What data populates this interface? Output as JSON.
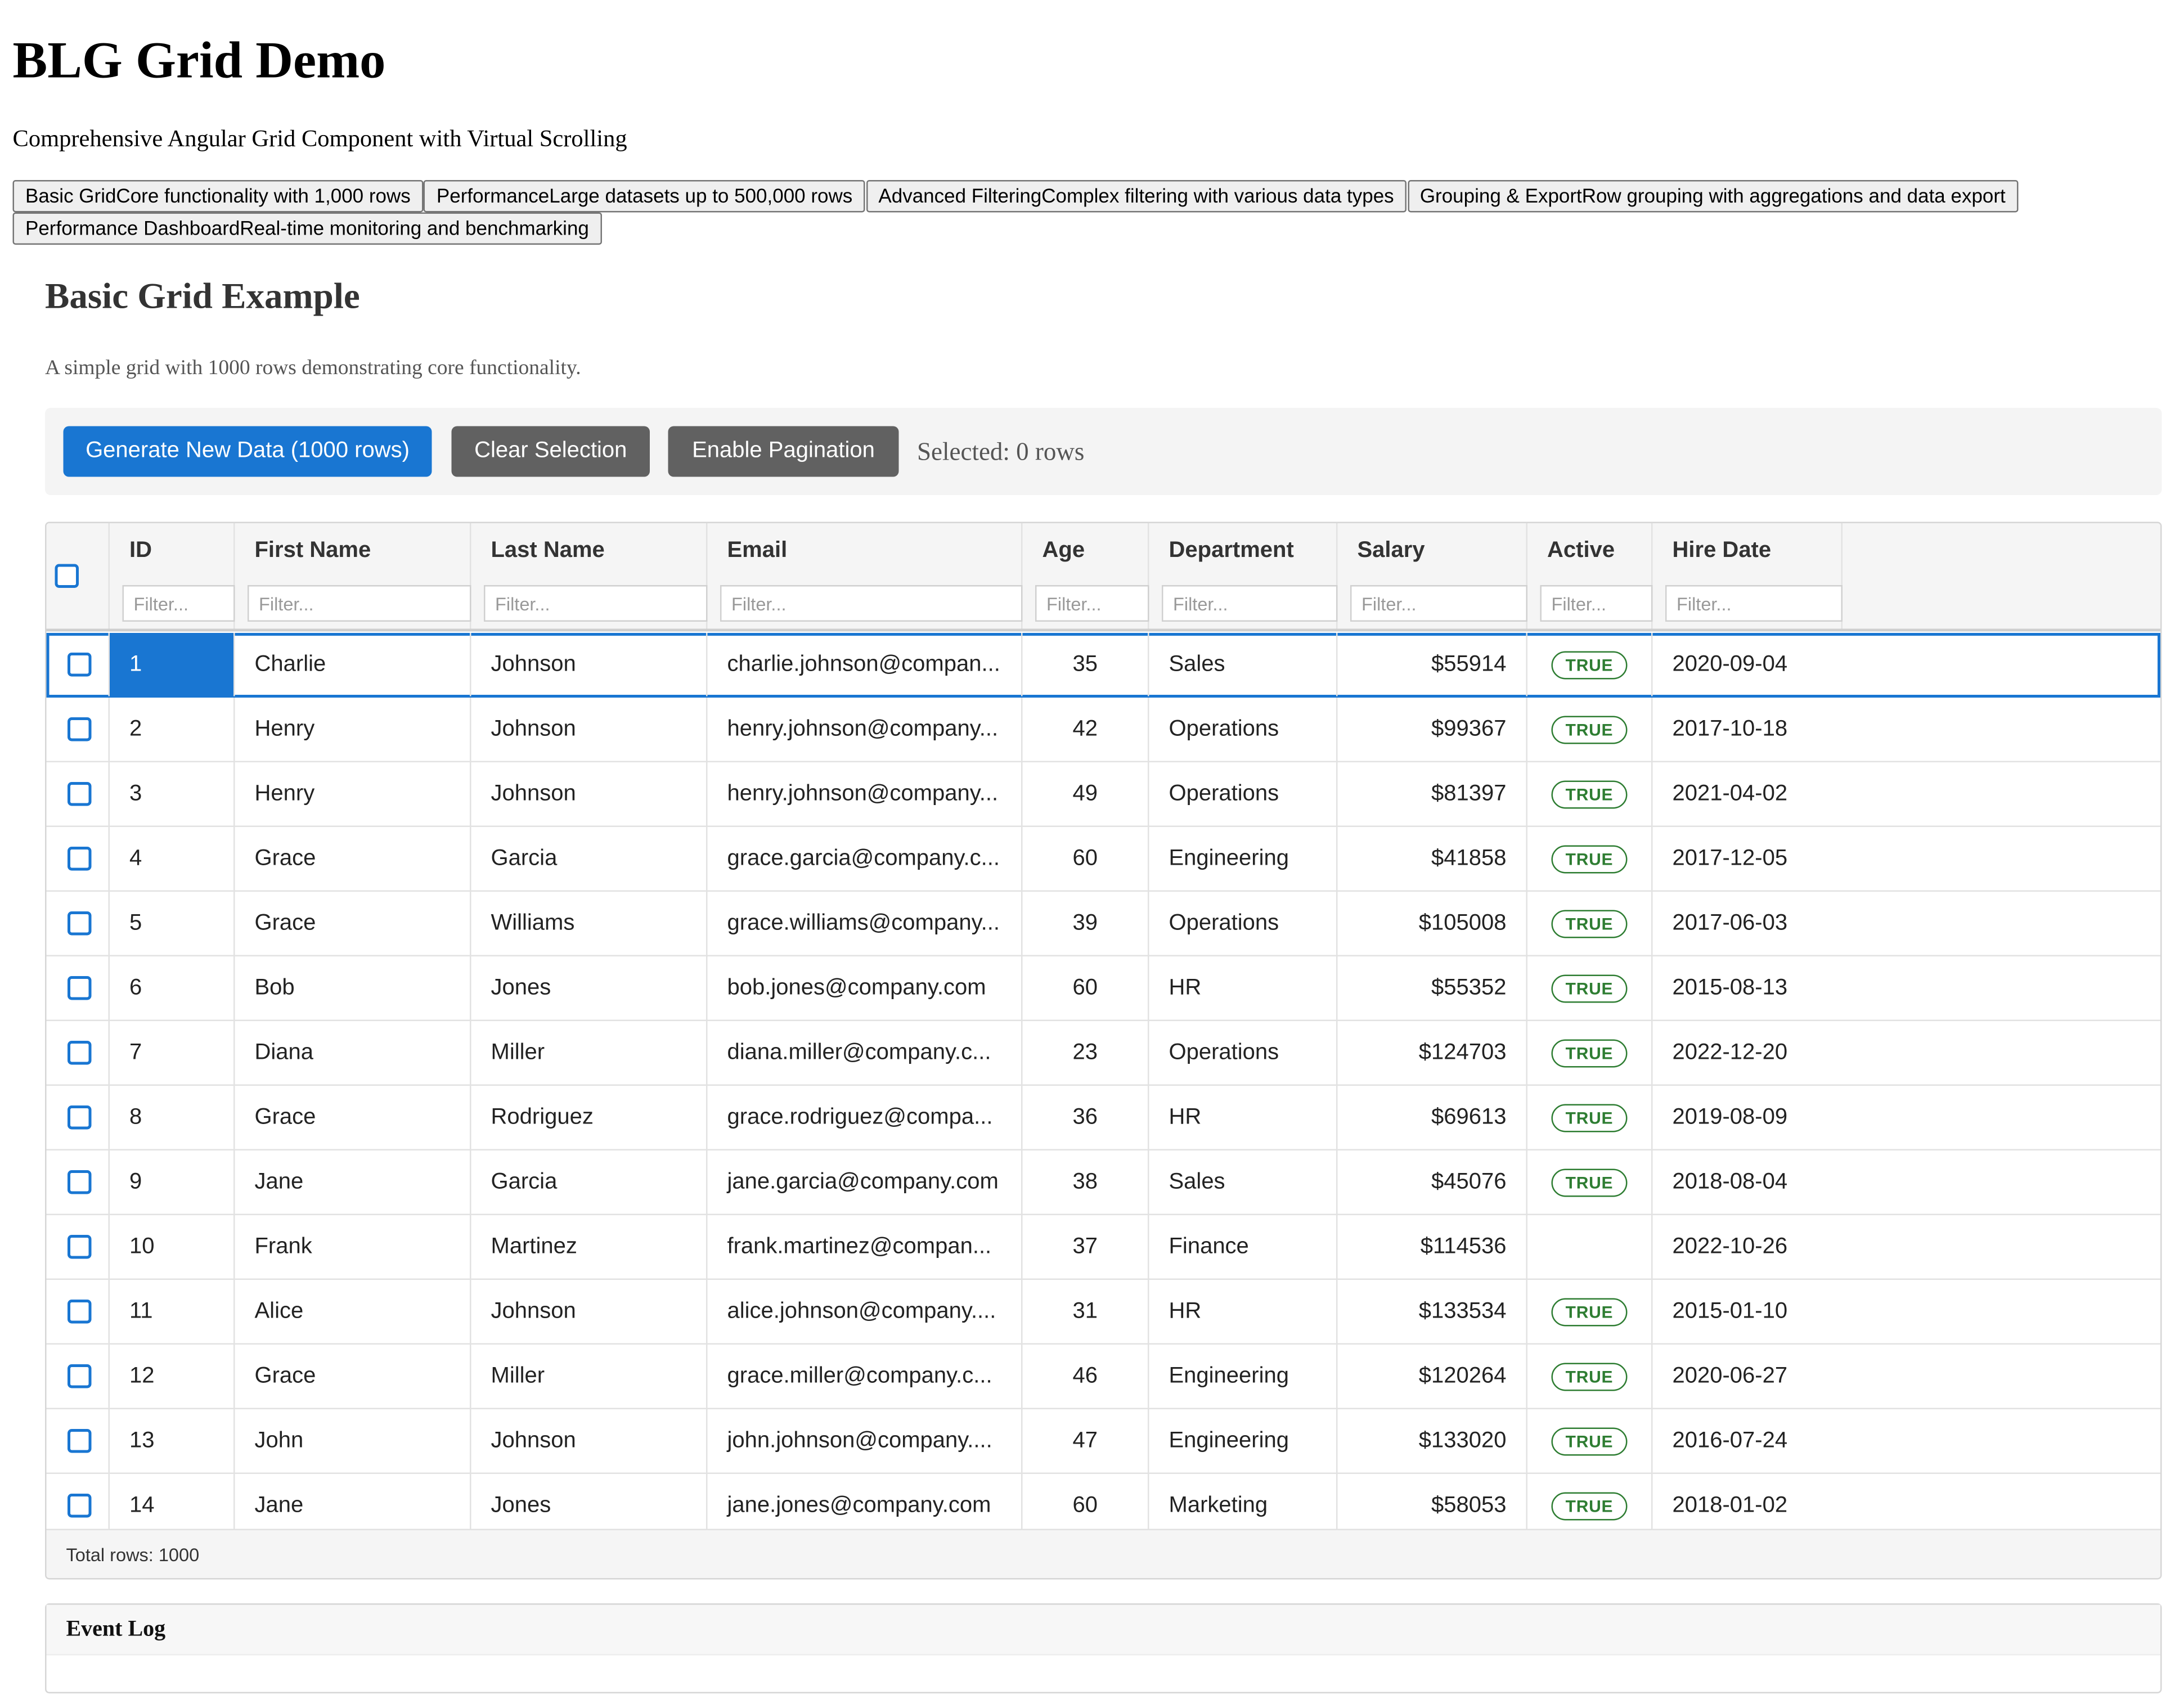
{
  "app": {
    "title": "BLG Grid Demo",
    "subtitle": "Comprehensive Angular Grid Component with Virtual Scrolling"
  },
  "nav": [
    {
      "label": "Basic GridCore functionality with 1,000 rows"
    },
    {
      "label": "PerformanceLarge datasets up to 500,000 rows"
    },
    {
      "label": "Advanced FilteringComplex filtering with various data types"
    },
    {
      "label": "Grouping & ExportRow grouping with aggregations and data export"
    },
    {
      "label": "Performance DashboardReal-time monitoring and benchmarking"
    }
  ],
  "section": {
    "title": "Basic Grid Example",
    "description": "A simple grid with 1000 rows demonstrating core functionality."
  },
  "controls": {
    "generate_label": "Generate New Data (1000 rows)",
    "clear_label": "Clear Selection",
    "pagination_label": "Enable Pagination",
    "selected_text": "Selected: 0 rows"
  },
  "grid": {
    "filter_placeholder": "Filter...",
    "columns": [
      "ID",
      "First Name",
      "Last Name",
      "Email",
      "Age",
      "Department",
      "Salary",
      "Active",
      "Hire Date"
    ],
    "rows": [
      {
        "id": "1",
        "first": "Charlie",
        "last": "Johnson",
        "email": "charlie.johnson@compan...",
        "age": "35",
        "dept": "Sales",
        "salary": "$55914",
        "active": "TRUE",
        "hire": "2020-09-04"
      },
      {
        "id": "2",
        "first": "Henry",
        "last": "Johnson",
        "email": "henry.johnson@company...",
        "age": "42",
        "dept": "Operations",
        "salary": "$99367",
        "active": "TRUE",
        "hire": "2017-10-18"
      },
      {
        "id": "3",
        "first": "Henry",
        "last": "Johnson",
        "email": "henry.johnson@company...",
        "age": "49",
        "dept": "Operations",
        "salary": "$81397",
        "active": "TRUE",
        "hire": "2021-04-02"
      },
      {
        "id": "4",
        "first": "Grace",
        "last": "Garcia",
        "email": "grace.garcia@company.c...",
        "age": "60",
        "dept": "Engineering",
        "salary": "$41858",
        "active": "TRUE",
        "hire": "2017-12-05"
      },
      {
        "id": "5",
        "first": "Grace",
        "last": "Williams",
        "email": "grace.williams@company...",
        "age": "39",
        "dept": "Operations",
        "salary": "$105008",
        "active": "TRUE",
        "hire": "2017-06-03"
      },
      {
        "id": "6",
        "first": "Bob",
        "last": "Jones",
        "email": "bob.jones@company.com",
        "age": "60",
        "dept": "HR",
        "salary": "$55352",
        "active": "TRUE",
        "hire": "2015-08-13"
      },
      {
        "id": "7",
        "first": "Diana",
        "last": "Miller",
        "email": "diana.miller@company.c...",
        "age": "23",
        "dept": "Operations",
        "salary": "$124703",
        "active": "TRUE",
        "hire": "2022-12-20"
      },
      {
        "id": "8",
        "first": "Grace",
        "last": "Rodriguez",
        "email": "grace.rodriguez@compa...",
        "age": "36",
        "dept": "HR",
        "salary": "$69613",
        "active": "TRUE",
        "hire": "2019-08-09"
      },
      {
        "id": "9",
        "first": "Jane",
        "last": "Garcia",
        "email": "jane.garcia@company.com",
        "age": "38",
        "dept": "Sales",
        "salary": "$45076",
        "active": "TRUE",
        "hire": "2018-08-04"
      },
      {
        "id": "10",
        "first": "Frank",
        "last": "Martinez",
        "email": "frank.martinez@compan...",
        "age": "37",
        "dept": "Finance",
        "salary": "$114536",
        "active": "",
        "hire": "2022-10-26"
      },
      {
        "id": "11",
        "first": "Alice",
        "last": "Johnson",
        "email": "alice.johnson@company....",
        "age": "31",
        "dept": "HR",
        "salary": "$133534",
        "active": "TRUE",
        "hire": "2015-01-10"
      },
      {
        "id": "12",
        "first": "Grace",
        "last": "Miller",
        "email": "grace.miller@company.c...",
        "age": "46",
        "dept": "Engineering",
        "salary": "$120264",
        "active": "TRUE",
        "hire": "2020-06-27"
      },
      {
        "id": "13",
        "first": "John",
        "last": "Johnson",
        "email": "john.johnson@company....",
        "age": "47",
        "dept": "Engineering",
        "salary": "$133020",
        "active": "TRUE",
        "hire": "2016-07-24"
      },
      {
        "id": "14",
        "first": "Jane",
        "last": "Jones",
        "email": "jane.jones@company.com",
        "age": "60",
        "dept": "Marketing",
        "salary": "$58053",
        "active": "TRUE",
        "hire": "2018-01-02"
      }
    ],
    "footer": "Total rows: 1000"
  },
  "event_log": {
    "title": "Event Log"
  },
  "colors": {
    "primary": "#1976d2",
    "secondary_button": "#616161",
    "active_badge": "#2e7d32"
  }
}
